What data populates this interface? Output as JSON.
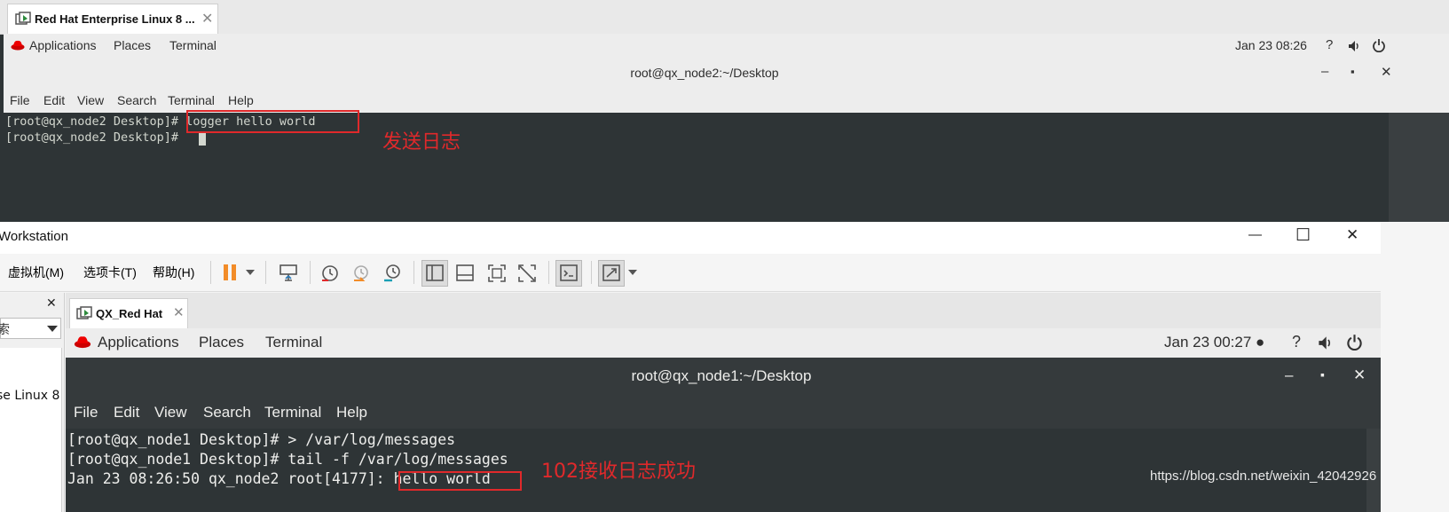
{
  "top_window": {
    "tab_title": "Red Hat Enterprise Linux 8 ...",
    "tab_close": "✕",
    "gnome_bar": {
      "applications": "Applications",
      "places": "Places",
      "terminal": "Terminal",
      "clock": "Jan 23  08:26",
      "help_glyph": "?"
    },
    "terminal_title": "root@qx_node2:~/Desktop",
    "window_controls": {
      "minimize": "–",
      "maximize": "▪",
      "close": "✕"
    },
    "menu": [
      "File",
      "Edit",
      "View",
      "Search",
      "Terminal",
      "Help"
    ],
    "lines": [
      {
        "prompt": "[root@qx_node2 Desktop]# ",
        "command": "logger hello world"
      },
      {
        "prompt": "[root@qx_node2 Desktop]# ",
        "command": ""
      }
    ],
    "annotation": "发送日志"
  },
  "workstation": {
    "title": "Workstation",
    "controls": {
      "minimize": "—",
      "maximize": "☐",
      "close": "✕"
    },
    "menu": [
      "虚拟机(M)",
      "选项卡(T)",
      "帮助(H)"
    ],
    "library": {
      "close": "✕",
      "search_stub": "索",
      "item_stub": "se Linux 8"
    }
  },
  "vm": {
    "tab_title": "QX_Red Hat",
    "tab_close": "✕",
    "gnome_bar": {
      "applications": "Applications",
      "places": "Places",
      "terminal": "Terminal",
      "clock": "Jan 23  00:27 ●",
      "help_glyph": "?"
    },
    "terminal_title": "root@qx_node1:~/Desktop",
    "window_controls": {
      "minimize": "–",
      "maximize": "▪",
      "close": "✕"
    },
    "menu": [
      "File",
      "Edit",
      "View",
      "Search",
      "Terminal",
      "Help"
    ],
    "lines": [
      {
        "prompt": "[root@qx_node1 Desktop]# ",
        "command": "> /var/log/messages"
      },
      {
        "prompt": "[root@qx_node1 Desktop]# ",
        "command": "tail -f /var/log/messages"
      },
      {
        "prompt": "Jan 23 08:26:50 qx_node2 root[4177]: ",
        "command": "hello world"
      }
    ],
    "annotation": "102接收日志成功"
  },
  "watermark": "https://blog.csdn.net/weixin_42042926",
  "colors": {
    "annotation": "#e0292b",
    "terminal_bg": "#2e3436",
    "vm_header": "#353a3c",
    "accent_orange": "#f28c28"
  }
}
